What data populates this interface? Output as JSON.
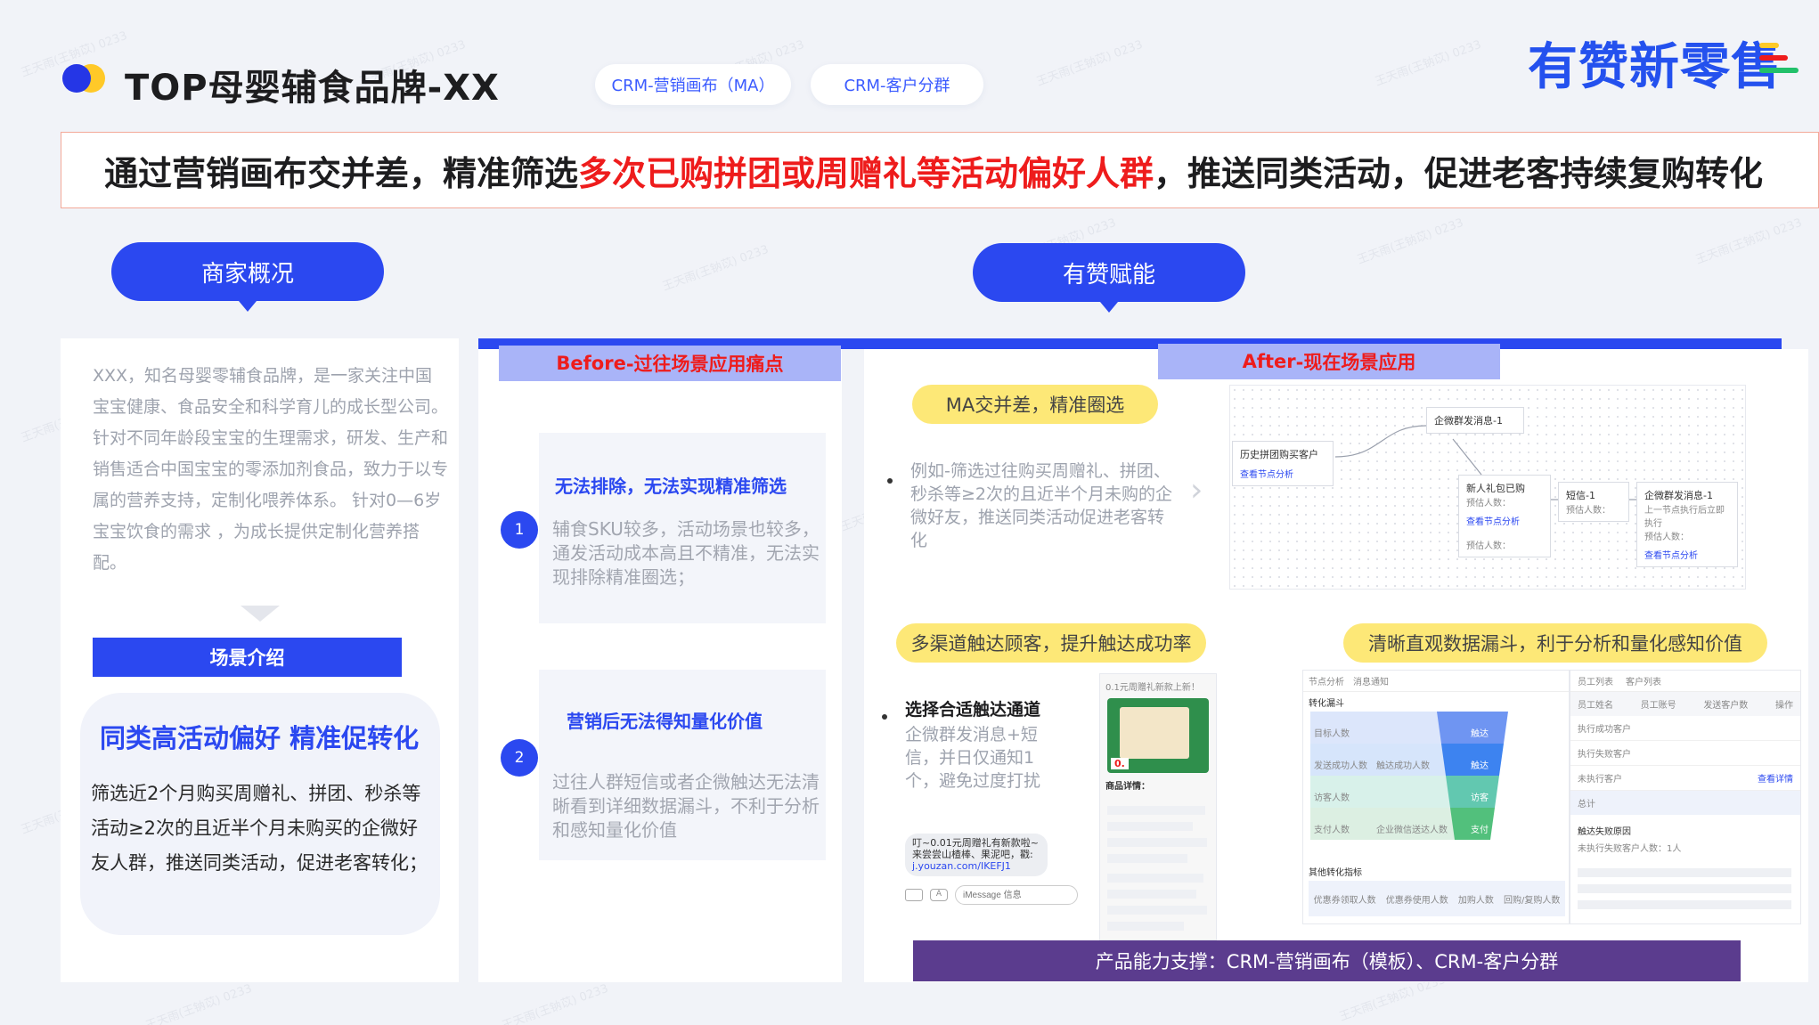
{
  "header": {
    "title": "TOP母婴辅食品牌-XX",
    "tags": [
      "CRM-营销画布（MA）",
      "CRM-客户分群"
    ],
    "brand": "有赞新零售",
    "brand_colors": [
      "#2451ee",
      "#ffc928",
      "#ee1c1c",
      "#22c06a"
    ]
  },
  "headline": {
    "part1": "通过营销画布交并差，精准筛选",
    "highlight": "多次已购拼团或周赠礼等活动偏好人群",
    "part2": "，推送同类活动，促进老客持续复购转化"
  },
  "left": {
    "bubble": "商家概况",
    "intro": "XXX，知名母婴零辅食品牌，是一家关注中国宝宝健康、食品安全和科学育儿的成长型公司。针对不同年龄段宝宝的生理需求，研发、生产和销售适合中国宝宝的零添加剂食品，致力于以专属的营养支持，定制化喂养体系。 针对0—6岁宝宝饮食的需求 ，为成长提供定制化营养搭配。",
    "scene_label": "场景介绍",
    "scene_title": "同类高活动偏好 精准促转化",
    "scene_body": "筛选近2个月购买周赠礼、拼团、秒杀等活动≥2次的且近半个月未购买的企微好友人群，推送同类活动，促进老客转化；"
  },
  "right": {
    "bubble": "有赞赋能",
    "before": {
      "label_red": "Before",
      "label_rest": "-过往场景应用痛点"
    },
    "pains": [
      {
        "num": "1",
        "title": "无法排除，无法实现精准筛选",
        "text": "辅食SKU较多，活动场景也较多，通发活动成本高且不精准，无法实现排除精准圈选；"
      },
      {
        "num": "2",
        "title": "营销后无法得知量化价值",
        "text": "过往人群短信或者企微触达无法清晰看到详细数据漏斗，不利于分析和感知量化价值"
      }
    ],
    "after": {
      "label_red": "After",
      "label_rest": "-现在场景应用"
    },
    "features": [
      {
        "pill": "MA交并差，精准圈选",
        "bullet": "例如-筛选过往购买周赠礼、拼团、秒杀等≥2次的且近半个月未购的企微好友，推送同类活动促进老客转化"
      },
      {
        "pill": "多渠道触达顾客，提升触达成功率",
        "bullet_title": "选择合适触达通道",
        "bullet": "企微群发消息+短信，并日仅通知1个，避免过度打扰"
      },
      {
        "pill": "清晰直观数据漏斗，利于分析和量化感知价值"
      }
    ],
    "canvas_nodes": {
      "start": "历史拼团购买客户",
      "start_link": "查看节点分析",
      "msg1": "企微群发消息-1",
      "split": "新人礼包已购",
      "split_a": "预估人数：",
      "split_b": "预估人数：",
      "split_link": "查看节点分析",
      "msg2_label": "短信-1",
      "msg2_sub": "预估人数：",
      "msg3": "企微群发消息-1",
      "msg3_sub": "上一节点执行后立即执行",
      "msg3_est": "预估人数：",
      "msg3_link": "查看节点分析"
    },
    "phone": {
      "header": "0.1元周赠礼新款上新！",
      "banner_price": "0.",
      "section": "商品详情：",
      "sms": "叮~0.01元周赠礼有新款啦~来尝尝山楂棒、果泥吧，戳:",
      "sms_link": "j.youzan.com/IKEFJ1",
      "input_placeholder": "iMessage 信息"
    },
    "funnel": {
      "tabs": [
        "节点分析",
        "消息通知"
      ],
      "section1": "转化漏斗",
      "rows": [
        "目标人数",
        "发送成功人数",
        "访客人数",
        "支付人数"
      ],
      "rows_right": [
        "触达成功人数",
        "企业微信送达人数"
      ],
      "tags": [
        "触达",
        "触达",
        "访客",
        "支付"
      ],
      "section2": "其他转化指标",
      "metrics": [
        "优惠券领取人数",
        "优惠券使用人数",
        "加购人数",
        "回购/复购人数"
      ],
      "colors": [
        "#6f95f2",
        "#3d83f0",
        "#62c8b0",
        "#52c07c"
      ]
    },
    "customer_table": {
      "tabs": [
        "员工列表",
        "客户列表"
      ],
      "cols": [
        "员工姓名",
        "员工账号",
        "发送客户数",
        "操作"
      ],
      "rows": [
        "执行成功客户",
        "执行失败客户",
        "未执行客户",
        "总计"
      ],
      "action": "查看详情",
      "section": "触达失败原因",
      "fail_row": "未执行失败客户人数：1人"
    },
    "support": "产品能力支撑：CRM-营销画布（模板）、CRM-客户分群"
  }
}
